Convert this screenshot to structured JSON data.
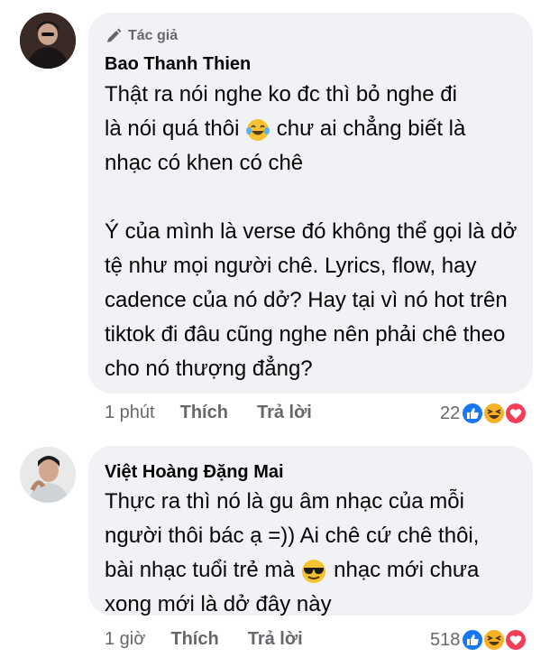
{
  "comments": [
    {
      "badge": "Tác giả",
      "author": "Bao Thanh Thien",
      "para1_line1": "Thật ra nói nghe ko đc thì bỏ nghe đi",
      "para1_line2_a": "là nói quá thôi",
      "para1_line2_b": "chư ai chẳng biết là",
      "para1_line3": "nhạc có khen có chê",
      "para2": "Ý của mình là verse đó không thể gọi là dở tệ như mọi người chê. Lyrics, flow, hay cadence của nó dở? Hay tại vì nó hot trên tiktok đi đâu cũng nghe nên phải chê theo cho nó thượng đẳng?",
      "time": "1 phút",
      "like": "Thích",
      "reply": "Trả lời",
      "reaction_count": "22",
      "reaction_icons": [
        "like-icon",
        "haha-icon",
        "love-icon"
      ]
    },
    {
      "author": "Việt Hoàng Đặng Mai",
      "line1": "Thực ra thì nó là gu âm nhạc của mỗi",
      "line2": "người thôi bác ạ =)) Ai chê cứ chê thôi,",
      "line3_a": "bài nhạc tuổi trẻ mà",
      "line3_b": "nhạc mới chưa",
      "line4": "xong mới là dở đây này",
      "time": "1 giờ",
      "like": "Thích",
      "reply": "Trả lời",
      "reaction_count": "518",
      "reaction_icons": [
        "like-icon",
        "haha-icon",
        "love-icon"
      ]
    }
  ],
  "colors": {
    "bubble": "#f0f2f5",
    "text": "#050505",
    "meta": "#65676b",
    "like_blue": "#1877f2",
    "love_red": "#f33e58",
    "haha_yellow": "#f7b125"
  }
}
